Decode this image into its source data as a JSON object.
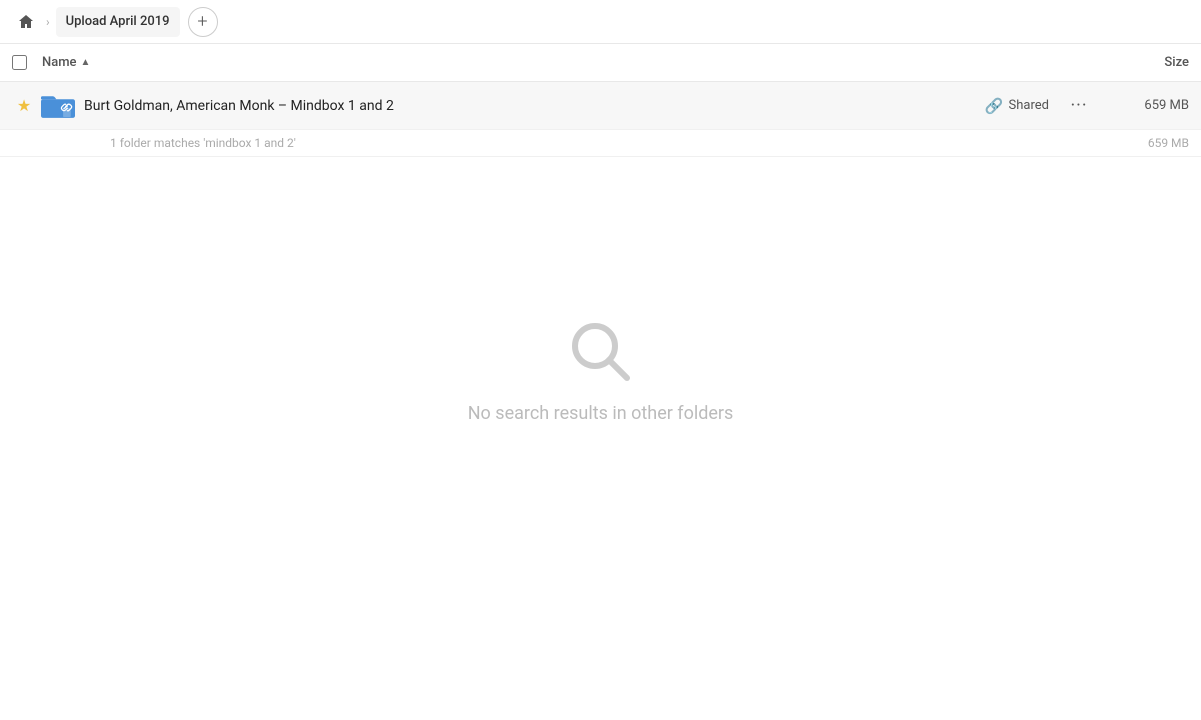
{
  "breadcrumb": {
    "home_icon": "🏠",
    "separator": "›",
    "current_folder": "Upload April 2019",
    "add_button_label": "+"
  },
  "columns": {
    "name_label": "Name",
    "sort_arrow": "▲",
    "size_label": "Size"
  },
  "file_row": {
    "star_icon": "★",
    "folder_name": "Burt Goldman, American Monk – Mindbox 1 and 2",
    "shared_label": "Shared",
    "more_icon": "···",
    "size": "659 MB"
  },
  "match_info": {
    "text": "1 folder matches 'mindbox 1 and 2'",
    "size": "659 MB"
  },
  "empty_state": {
    "message": "No search results in other folders"
  },
  "colors": {
    "folder_blue": "#4a90d9",
    "folder_dark": "#2c6fad",
    "star_yellow": "#f0c040",
    "shared_text": "#555555",
    "empty_icon": "#cccccc",
    "empty_text": "#bbbbbb"
  }
}
